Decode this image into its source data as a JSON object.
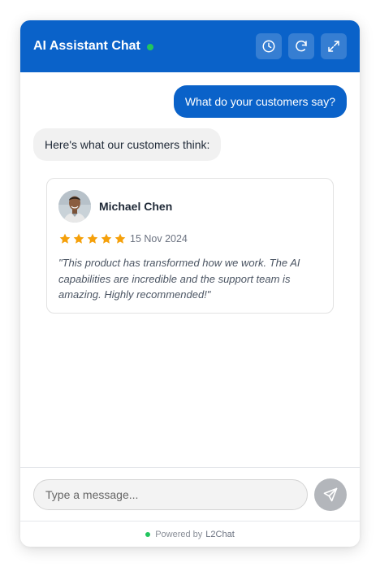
{
  "header": {
    "title": "AI Assistant Chat",
    "status": "online",
    "buttons": [
      {
        "icon": "clock-icon",
        "name": "history"
      },
      {
        "icon": "refresh-icon",
        "name": "refresh"
      },
      {
        "icon": "expand-icon",
        "name": "expand"
      }
    ]
  },
  "messages": [
    {
      "role": "user",
      "text": "What do your customers say?"
    },
    {
      "role": "assistant",
      "text": "Here's what our customers think:"
    }
  ],
  "review": {
    "name": "Michael Chen",
    "rating": 5,
    "date": "15 Nov 2024",
    "text": "\"This product has transformed how we work. The AI capabilities are incredible and the support team is amazing. Highly recommended!\""
  },
  "input": {
    "placeholder": "Type a message...",
    "value": ""
  },
  "footer": {
    "prefix": "Powered by",
    "brand": "L2Chat"
  },
  "colors": {
    "primary": "#0a62c9",
    "online": "#22c55e",
    "star": "#f5a00a"
  }
}
